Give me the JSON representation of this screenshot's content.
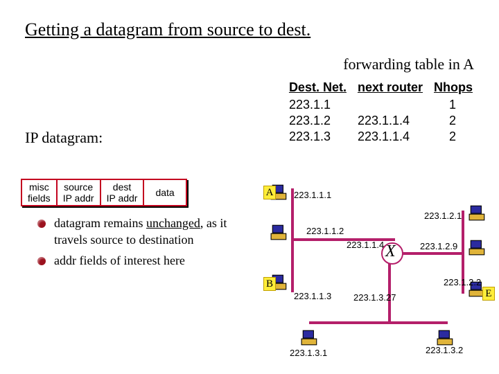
{
  "title": "Getting a datagram from source to dest.",
  "subtitle": "forwarding table in A",
  "forwarding_table": {
    "headers": {
      "c1": "Dest. Net.",
      "c2": "next router",
      "c3": "Nhops"
    },
    "rows": [
      {
        "dest": "223.1.1",
        "next": "",
        "hops": "1"
      },
      {
        "dest": "223.1.2",
        "next": "223.1.1.4",
        "hops": "2"
      },
      {
        "dest": "223.1.3",
        "next": "223.1.1.4",
        "hops": "2"
      }
    ]
  },
  "ip_datagram_label": "IP datagram:",
  "packet": {
    "misc": "misc\nfields",
    "src": "source\nIP addr",
    "dest": "dest\nIP addr",
    "data": "data"
  },
  "bullets": [
    "datagram remains unchanged, as it travels source to destination",
    "addr fields of interest here"
  ],
  "network": {
    "nodes": {
      "A": "A",
      "B": "B",
      "E": "E"
    },
    "router": "X",
    "ips": {
      "a": "223.1.1.1",
      "h12": "223.1.1.2",
      "b": "223.1.1.3",
      "r14": "223.1.1.4",
      "r27": "223.1.3.27",
      "h21": "223.1.2.1",
      "h29": "223.1.2.9",
      "e": "223.1.2.2",
      "h31": "223.1.3.1",
      "h32": "223.1.3.2"
    }
  }
}
